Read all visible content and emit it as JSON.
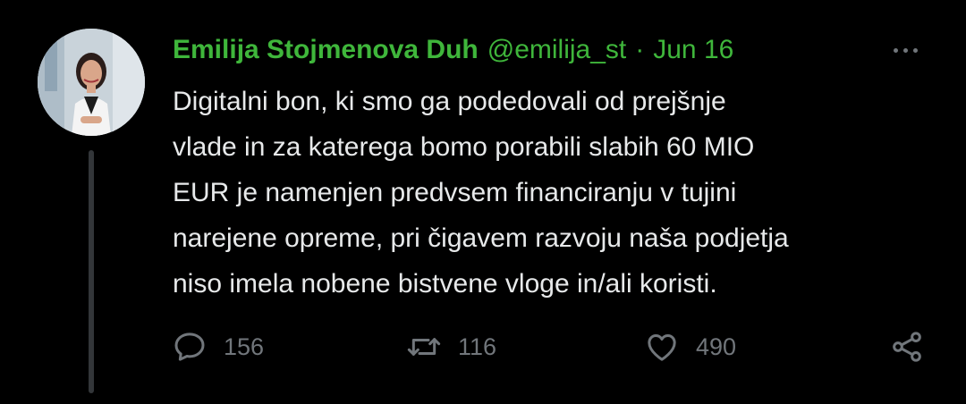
{
  "tweet": {
    "author_name": "Emilija Stojmenova Duh",
    "handle": "@emilija_st",
    "separator": "·",
    "date": "Jun 16",
    "text_lines": [
      "Digitalni bon, ki smo ga podedovali od prejšnje",
      "vlade in za katerega bomo porabili slabih 60 MIO",
      "EUR je namenjen predvsem financiranju v tujini",
      "narejene opreme, pri čigavem razvoju naša podjetja",
      "niso imela nobene bistvene vloge in/ali koristi."
    ],
    "replies": "156",
    "retweets": "116",
    "likes": "490"
  },
  "icons": {
    "reply": "speech-bubble-icon",
    "retweet": "retweet-arrows-icon",
    "like": "heart-icon",
    "share": "share-nodes-icon",
    "more": "more-dots-icon"
  },
  "colors": {
    "background": "#000000",
    "accent": "#3fb63b",
    "text": "#e7e9ea",
    "muted": "#71767b"
  }
}
